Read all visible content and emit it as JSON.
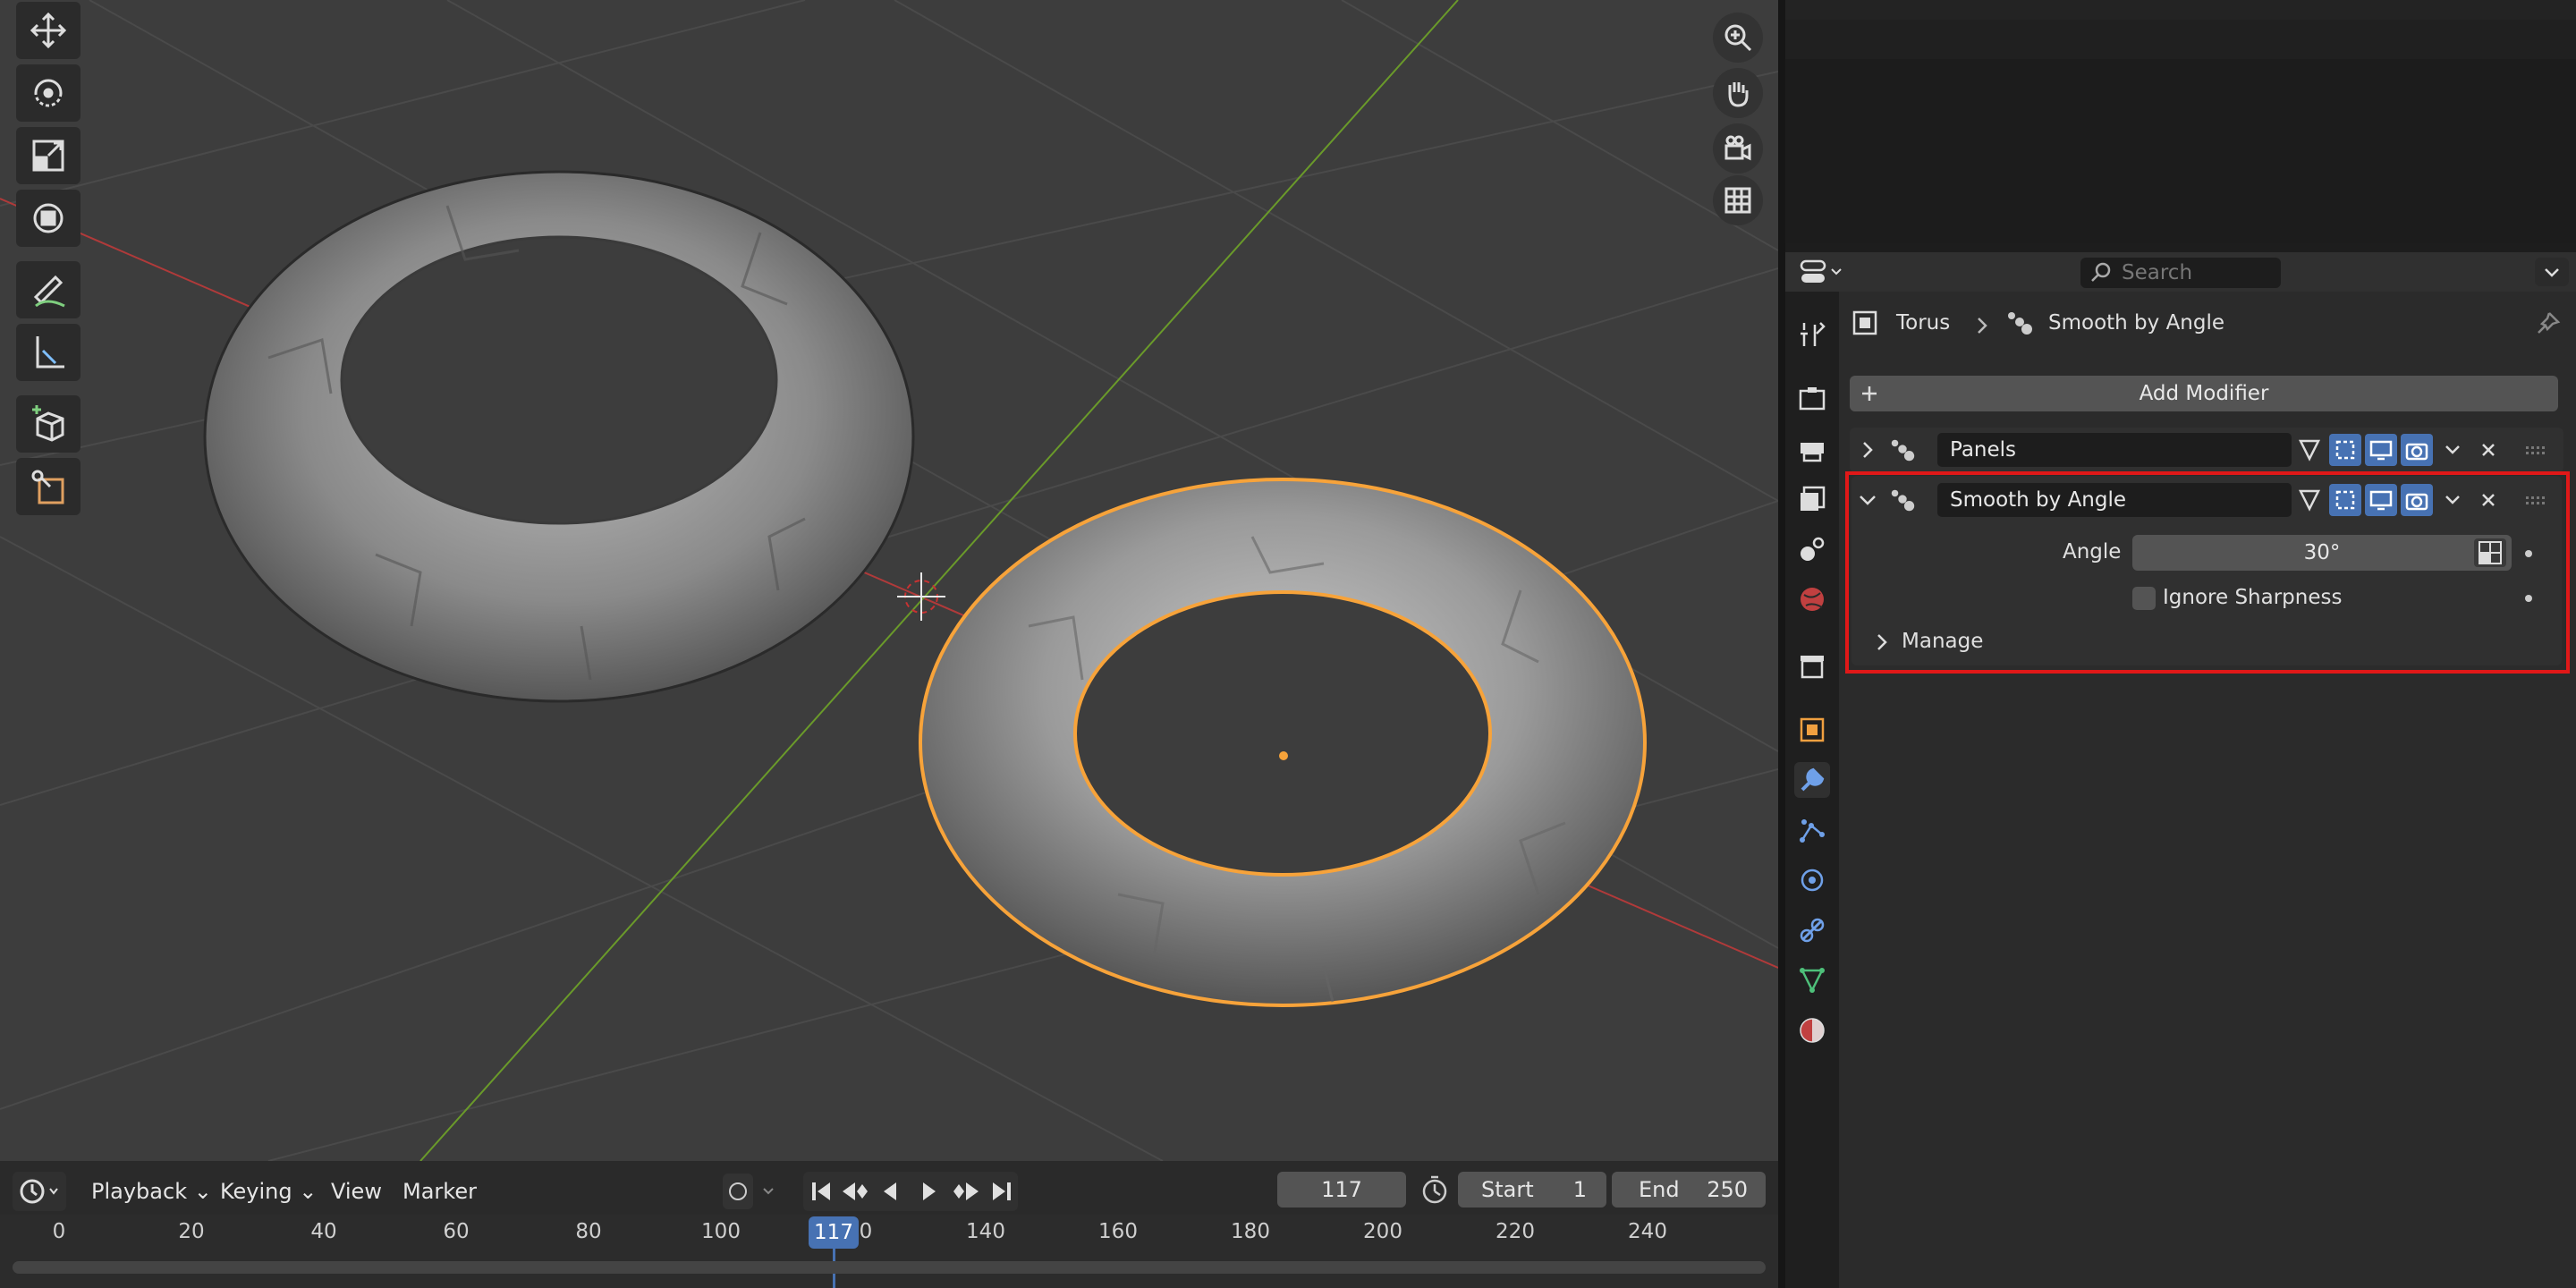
{
  "viewport": {
    "gizmos": [
      "zoom-icon",
      "hand-pan-icon",
      "camera-icon",
      "grid-icon"
    ],
    "tools": [
      "move-icon",
      "rotate-icon",
      "scale-icon",
      "transform-icon",
      "annotate-icon",
      "measure-icon",
      "add-cube-icon",
      "knife-icon"
    ]
  },
  "timeline": {
    "menus": [
      "Playback",
      "Keying",
      "View",
      "Marker"
    ],
    "current_frame": "117",
    "start_label": "Start",
    "start_value": "1",
    "end_label": "End",
    "end_value": "250",
    "ticks": [
      "0",
      "20",
      "40",
      "60",
      "80",
      "100",
      "140",
      "160",
      "180",
      "200",
      "220",
      "240"
    ],
    "playhead_label": "117",
    "playhead_suffix": "0"
  },
  "properties": {
    "search_placeholder": "Search",
    "breadcrumb_object": "Torus",
    "breadcrumb_modifier": "Smooth by Angle",
    "add_modifier": "Add Modifier",
    "modifiers": [
      {
        "name": "Panels",
        "expanded": false
      },
      {
        "name": "Smooth by Angle",
        "expanded": true
      }
    ],
    "angle_label": "Angle",
    "angle_value": "30°",
    "ignore_sharpness_label": "Ignore Sharpness",
    "ignore_sharpness_checked": false,
    "manage_label": "Manage"
  },
  "colors": {
    "selection_outline": "#f7a33a",
    "x_axis": "#b03a3a",
    "y_axis": "#6a9a2a",
    "highlight_box": "#e01818",
    "accent_blue": "#4772b3"
  }
}
